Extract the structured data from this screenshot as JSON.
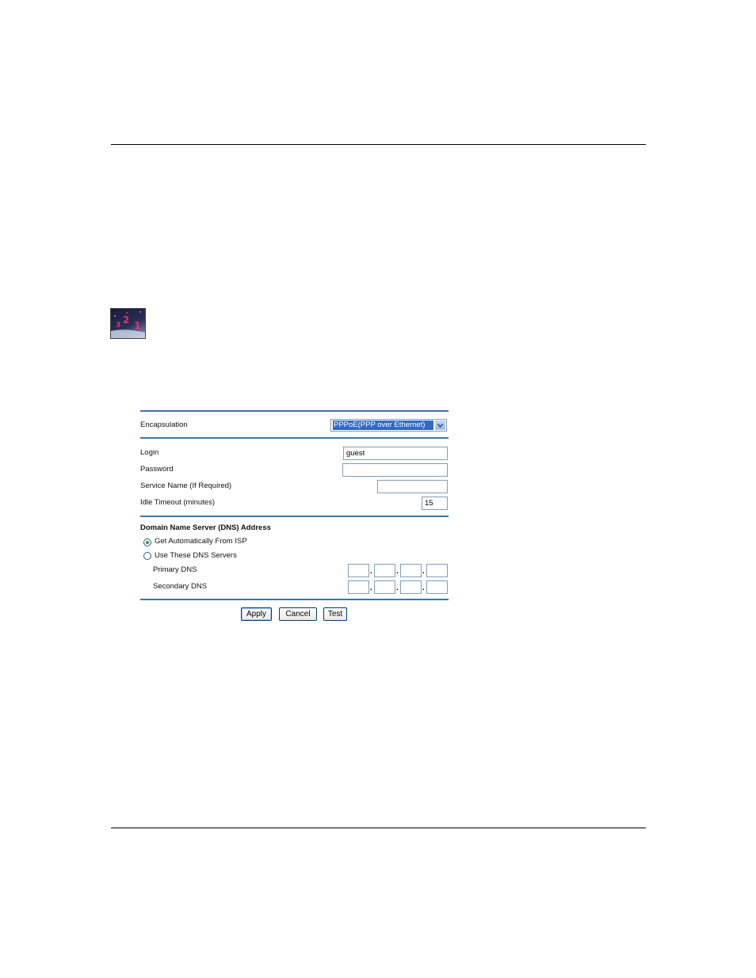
{
  "form": {
    "encapsulation_label": "Encapsulation",
    "encapsulation_value": "PPPoE(PPP over Ethernet)",
    "login_label": "Login",
    "login_value": "guest",
    "password_label": "Password",
    "password_value": "",
    "service_name_label": "Service Name  (If Required)",
    "service_name_value": "",
    "idle_timeout_label": "Idle Timeout (minutes)",
    "idle_timeout_value": "15",
    "dns_heading": "Domain Name Server (DNS) Address",
    "dns_auto_label": "Get Automatically From ISP",
    "dns_auto_selected": true,
    "dns_manual_label": "Use These DNS Servers",
    "primary_dns_label": "Primary DNS",
    "secondary_dns_label": "Secondary DNS",
    "separator": "."
  },
  "buttons": {
    "apply": "Apply",
    "cancel": "Cancel",
    "test": "Test"
  },
  "colors": {
    "section_rule": "#3a77a8",
    "selection_highlight": "#316ac5"
  },
  "icons": {
    "tip_icon": "countdown-123-icon"
  }
}
